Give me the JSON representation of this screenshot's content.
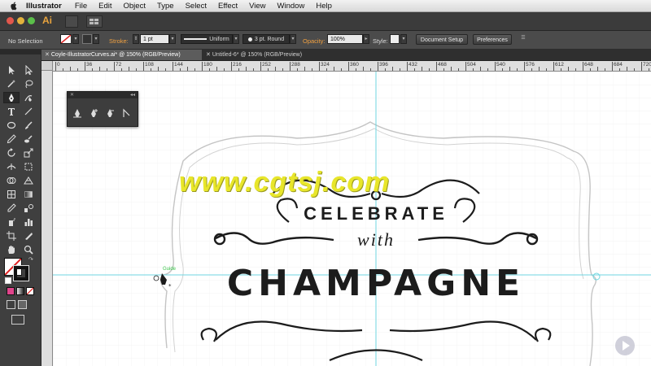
{
  "menubar": {
    "app_name": "Illustrator",
    "items": [
      "File",
      "Edit",
      "Object",
      "Type",
      "Select",
      "Effect",
      "View",
      "Window",
      "Help"
    ]
  },
  "appbar": {
    "logo": "Ai"
  },
  "control": {
    "selection": "No Selection",
    "stroke_label": "Stroke:",
    "stroke_weight": "1 pt",
    "profile": "Uniform",
    "brush": "3 pt. Round",
    "opacity_label": "Opacity:",
    "opacity": "100%",
    "style_label": "Style:",
    "doc_setup": "Document Setup",
    "preferences": "Preferences"
  },
  "tabs": [
    {
      "label": "Coyle-IllustratorCurves.ai* @ 150% (RGB/Preview)",
      "active": true
    },
    {
      "label": "Untitled-6* @ 150% (RGB/Preview)",
      "active": false
    }
  ],
  "ruler": {
    "labels": [
      "0",
      "36",
      "72",
      "108",
      "144",
      "180",
      "216",
      "252",
      "288",
      "324",
      "360",
      "396",
      "432",
      "468",
      "504",
      "540",
      "576",
      "612",
      "648",
      "684",
      "720"
    ]
  },
  "artwork": {
    "line1": "CELEBRATE",
    "line2": "with",
    "line3": "CHAMPAGNE",
    "smart_guide": "Guide"
  },
  "watermark": "www.cgtsj.com",
  "colors": {
    "guide": "#6fd6e0",
    "watermark": "#e8e62a",
    "ink": "#1c1c1c",
    "sketch": "#bdbdbd",
    "accent": "#f0a040"
  }
}
